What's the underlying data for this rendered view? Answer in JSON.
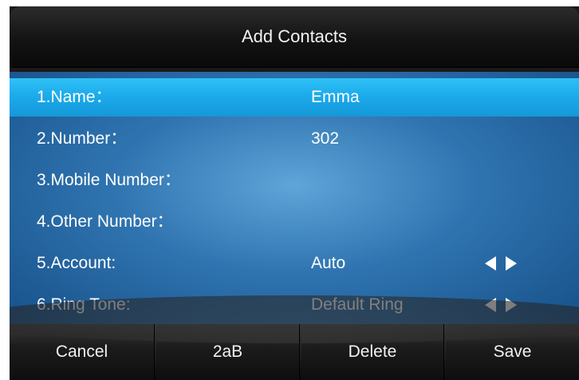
{
  "header": {
    "title": "Add Contacts"
  },
  "form": {
    "rows": [
      {
        "label": "1.Name：",
        "value": "Emma",
        "selected": true
      },
      {
        "label": "2.Number：",
        "value": "302"
      },
      {
        "label": "3.Mobile Number：",
        "value": ""
      },
      {
        "label": "4.Other Number：",
        "value": ""
      },
      {
        "label": "5.Account:",
        "value": "Auto",
        "has_arrows": true
      },
      {
        "label": "6.Ring Tone:",
        "value": "Default Ring",
        "has_arrows": true
      }
    ]
  },
  "softkeys": {
    "cancel": "Cancel",
    "input_mode": "2aB",
    "delete": "Delete",
    "save": "Save"
  },
  "colors": {
    "selection": "#1aa9ea",
    "background": "#2f74b0",
    "softkey_bar": "#1c1c1c"
  },
  "icons": {
    "left_arrow": "triangle-left-icon",
    "right_arrow": "triangle-right-icon"
  }
}
